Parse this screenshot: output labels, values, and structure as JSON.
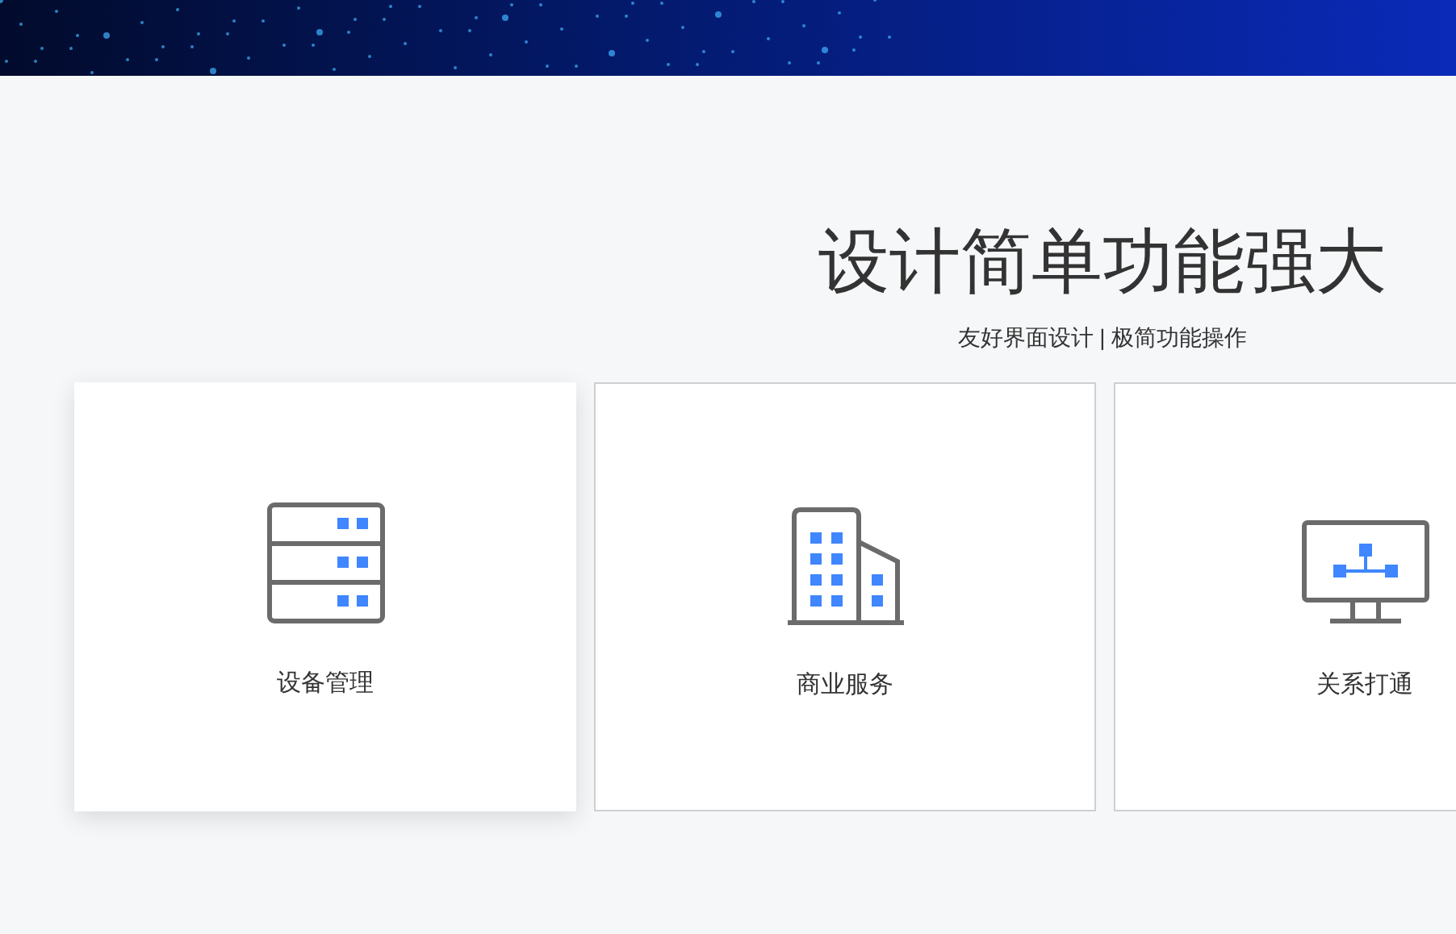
{
  "hero": {
    "title": "设计简单功能强大",
    "subtitle": "友好界面设计 | 极简功能操作"
  },
  "cards": [
    {
      "label": "设备管理",
      "kind": "server",
      "selected": true
    },
    {
      "label": "商业服务",
      "kind": "building",
      "selected": false
    },
    {
      "label": "关系打通",
      "kind": "monitor",
      "selected": false
    }
  ]
}
